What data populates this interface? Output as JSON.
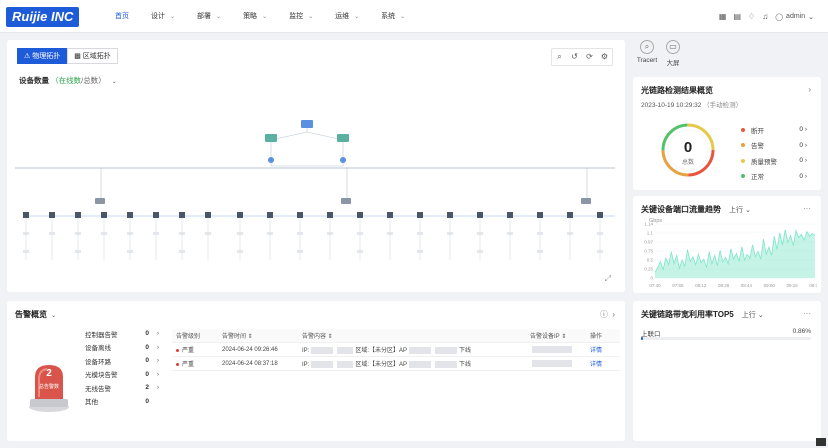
{
  "nav": {
    "logo": "Ruijie INC",
    "items": [
      {
        "label": "首页",
        "dropdown": false
      },
      {
        "label": "设计",
        "dropdown": true
      },
      {
        "label": "部署",
        "dropdown": true
      },
      {
        "label": "策略",
        "dropdown": true
      },
      {
        "label": "监控",
        "dropdown": true
      },
      {
        "label": "运维",
        "dropdown": true
      },
      {
        "label": "系统",
        "dropdown": true
      }
    ],
    "user": "admin"
  },
  "topology": {
    "tabs": [
      "物理拓扑",
      "区域拓扑"
    ],
    "device_count_label": "设备数量",
    "online_label": "在线数",
    "total_label": "总数"
  },
  "tools": {
    "tracert": "Tracert",
    "bigscreen": "大屏"
  },
  "fiber": {
    "title": "光链路检测结果概览",
    "time": "2023-10-19 10:29:32",
    "hint": "（手动检测）",
    "total": "0",
    "total_label": "总数",
    "legend": [
      {
        "name": "断开",
        "value": "0",
        "color": "#e8553e"
      },
      {
        "name": "告警",
        "value": "0",
        "color": "#e8a13e"
      },
      {
        "name": "质量预警",
        "value": "0",
        "color": "#e6c84a"
      },
      {
        "name": "正常",
        "value": "0",
        "color": "#52c26a"
      }
    ]
  },
  "traffic": {
    "title": "关键设备端口流量趋势",
    "direction": "上行",
    "unit": "Gbps"
  },
  "chart_data": {
    "type": "area",
    "x": [
      "07:40",
      "07:55",
      "08:12",
      "08:28",
      "08:44",
      "09:00",
      "09:16",
      "09:32"
    ],
    "yticks": [
      "1.14",
      "1.1",
      "0.97",
      "0.75",
      "0.5",
      "0.25",
      "0"
    ],
    "ylim": [
      0,
      1.14
    ],
    "values": [
      0.12,
      0.22,
      0.35,
      0.18,
      0.42,
      0.28,
      0.55,
      0.3,
      0.48,
      0.2,
      0.38,
      0.25,
      0.6,
      0.35,
      0.45,
      0.28,
      0.5,
      0.32,
      0.4,
      0.22,
      0.55,
      0.3,
      0.48,
      0.26,
      0.58,
      0.34,
      0.44,
      0.3,
      0.62,
      0.4,
      0.52,
      0.35,
      0.66,
      0.38,
      0.5,
      0.42,
      0.7,
      0.45,
      0.56,
      0.4,
      0.82,
      0.5,
      0.65,
      0.48,
      0.88,
      0.6,
      0.95,
      0.7,
      1.02,
      0.75,
      0.9,
      0.68,
      1.0,
      0.85,
      0.92,
      0.8,
      0.98,
      0.88,
      0.94,
      0.9
    ],
    "grid": true,
    "color": "#7ee6c8"
  },
  "bandwidth": {
    "title": "关键链路带宽利用率TOP5",
    "direction": "上行",
    "rows": [
      {
        "label": "上联口",
        "value": "0.86%",
        "fraction": 0.0086
      }
    ]
  },
  "alarm": {
    "title": "告警概览",
    "total": "2",
    "total_label": "总告警数",
    "categories": [
      {
        "name": "控制器告警",
        "value": "0"
      },
      {
        "name": "设备离线",
        "value": "0"
      },
      {
        "name": "设备环路",
        "value": "0"
      },
      {
        "name": "光模块告警",
        "value": "0"
      },
      {
        "name": "无线告警",
        "value": "2"
      },
      {
        "name": "其他",
        "value": "0"
      }
    ],
    "columns": [
      "告警级别",
      "告警时间",
      "告警内容",
      "告警设备IP",
      "操作"
    ],
    "rows": [
      {
        "level": "严重",
        "time": "2024-06-24 09:26:46",
        "content_prefix": "IP:",
        "content_mid": "区域:【未分区】AP",
        "content_suffix": "下线",
        "action": "详情"
      },
      {
        "level": "严重",
        "time": "2024-06-24 08:37:18",
        "content_prefix": "IP:",
        "content_mid": "区域:【未分区】AP",
        "content_suffix": "下线",
        "action": "详情"
      }
    ]
  }
}
